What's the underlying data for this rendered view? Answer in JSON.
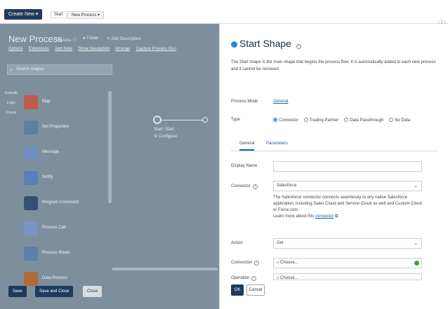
{
  "topbar": {
    "create_label": "Create New ▾",
    "tabs": [
      {
        "label": "Start"
      },
      {
        "label": "New Process ▾"
      }
    ]
  },
  "left": {
    "title": "New Process",
    "meta": [
      "Process ⓘ",
      "● Folder",
      "✎ Add Description"
    ],
    "menu": [
      "Options",
      "Extensions",
      "Add Note",
      "Show Navigation",
      "Arrange",
      "Capture Process Run"
    ],
    "search_placeholder": "Search shapes",
    "vtabs": [
      "Execute",
      "Logic",
      "Conns"
    ],
    "shapes": [
      {
        "label": "Map",
        "color": "#c05a4a"
      },
      {
        "label": "Set Properties",
        "color": "#5f7ea0"
      },
      {
        "label": "Message",
        "color": "#6f8fc0"
      },
      {
        "label": "Notify",
        "color": "#5a7fb5"
      },
      {
        "label": "Program Command",
        "color": "#35506e"
      },
      {
        "label": "Process Call",
        "color": "#7a95c2"
      },
      {
        "label": "Process Route",
        "color": "#5d7fa8"
      },
      {
        "label": "Data Process",
        "color": "#b06a3a"
      }
    ],
    "canvas": {
      "node_label_1": "Start: Start",
      "node_label_2": "① Configure"
    },
    "buttons": {
      "save": "Save",
      "save_close": "Save and Close",
      "close": "Close"
    }
  },
  "panel": {
    "title": "Start Shape",
    "description": "The Start shape is the main shape that begins the process flow. It is automatically added to each new process and it cannot be removed.",
    "process_mode_label": "Process Mode",
    "process_mode_value": "General",
    "type_label": "Type",
    "type_options": [
      {
        "label": "Connector",
        "selected": true
      },
      {
        "label": "Trading Partner",
        "selected": false
      },
      {
        "label": "Data Passthrough",
        "selected": false
      },
      {
        "label": "No Data",
        "selected": false
      }
    ],
    "tabs": [
      "General",
      "Parameters"
    ],
    "display_name_label": "Display Name",
    "display_name_value": "",
    "connector_label": "Connector",
    "connector_value": "Salesforce",
    "connector_desc": "The Salesforce connector connects seamlessly to any native Salesforce application, including Sales Cloud and Service Cloud as well and Custom Cloud or Force.com.",
    "learn_more_prefix": "Learn more about this ",
    "learn_more_link": "connector",
    "action_label": "Action",
    "action_value": "Get",
    "connection_label": "Connection",
    "connection_placeholder": "Choose...",
    "operation_label": "Operation",
    "operation_placeholder": "Choose...",
    "ok_label": "OK",
    "cancel_label": "Cancel"
  },
  "colors": {
    "accent": "#1f3a5c",
    "link": "#1f5f9e",
    "overlay": "#7d8f9c",
    "status_ok": "#4a9d3a"
  }
}
